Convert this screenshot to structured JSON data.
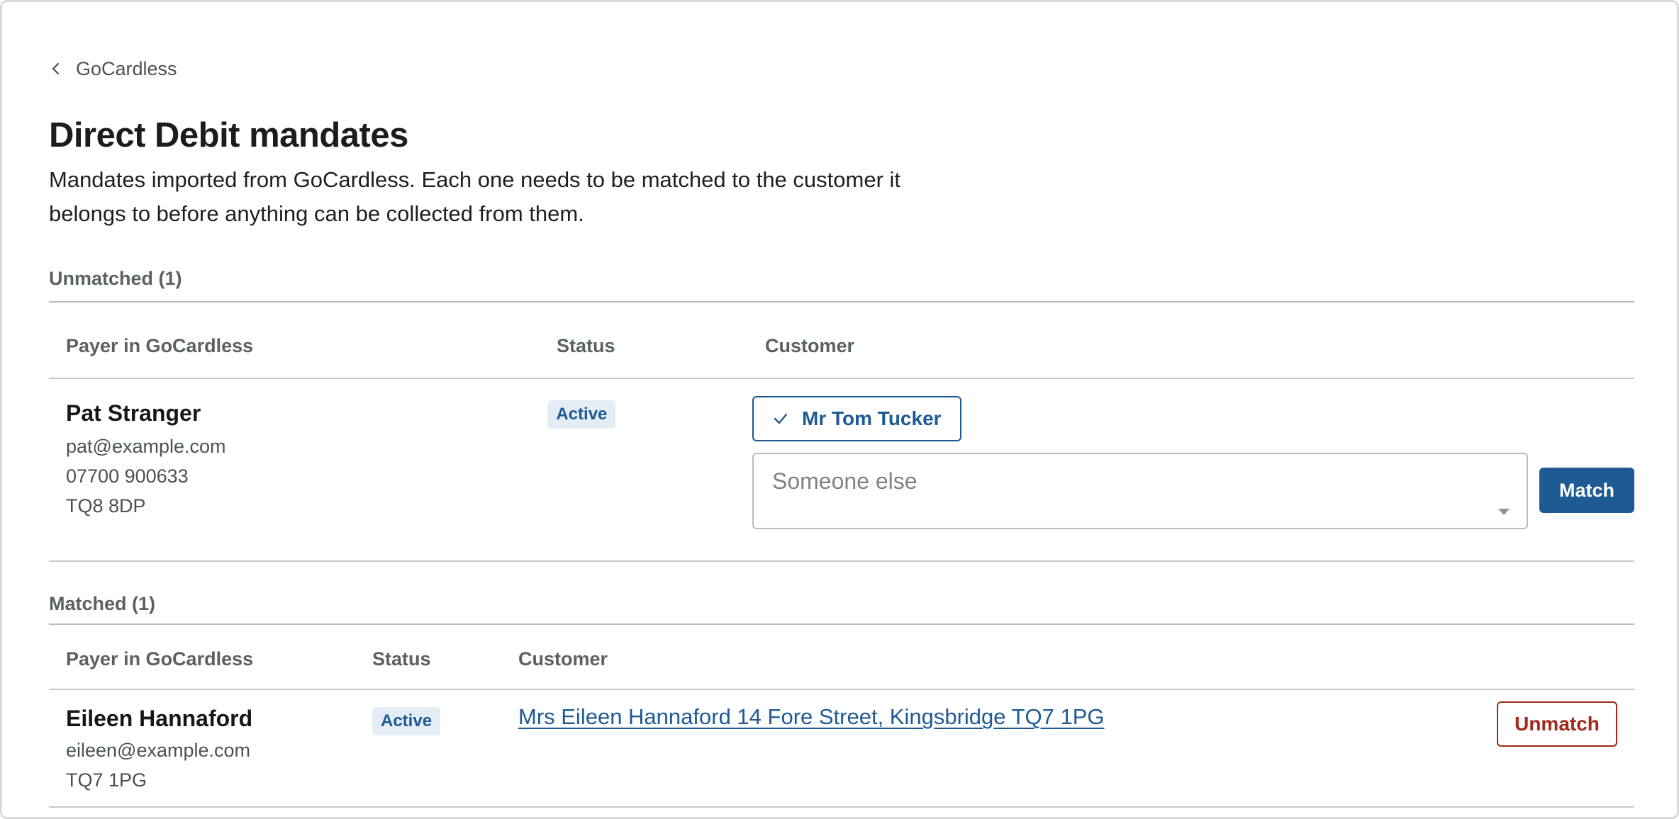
{
  "breadcrumb": {
    "label": "GoCardless",
    "icon": "chevron-left-icon"
  },
  "page": {
    "title": "Direct Debit mandates",
    "intro": "Mandates imported from GoCardless. Each one needs to be matched to the customer it belongs to before anything can be collected from them."
  },
  "unmatched": {
    "heading": "Unmatched (1)",
    "columns": [
      "Payer in GoCardless",
      "Status",
      "Customer"
    ],
    "rows": [
      {
        "payer_name": "Pat Stranger",
        "email": "pat@example.com",
        "phone": "07700 900633",
        "postcode": "TQ8 8DP",
        "status": "Active",
        "suggested_customer": "Mr Tom Tucker",
        "select_placeholder": "Someone else",
        "match_label": "Match"
      }
    ]
  },
  "matched": {
    "heading": "Matched (1)",
    "columns": [
      "Payer in GoCardless",
      "Status",
      "Customer"
    ],
    "rows": [
      {
        "payer_name": "Eileen Hannaford",
        "email": "eileen@example.com",
        "postcode": "TQ7 1PG",
        "status": "Active",
        "customer_link": "Mrs Eileen Hannaford 14 Fore Street, Kingsbridge TQ7 1PG",
        "unmatch_label": "Unmatch"
      }
    ]
  },
  "colors": {
    "accent": "#1e5a94",
    "danger": "#a3281d",
    "badge_bg": "#e4edf6"
  }
}
